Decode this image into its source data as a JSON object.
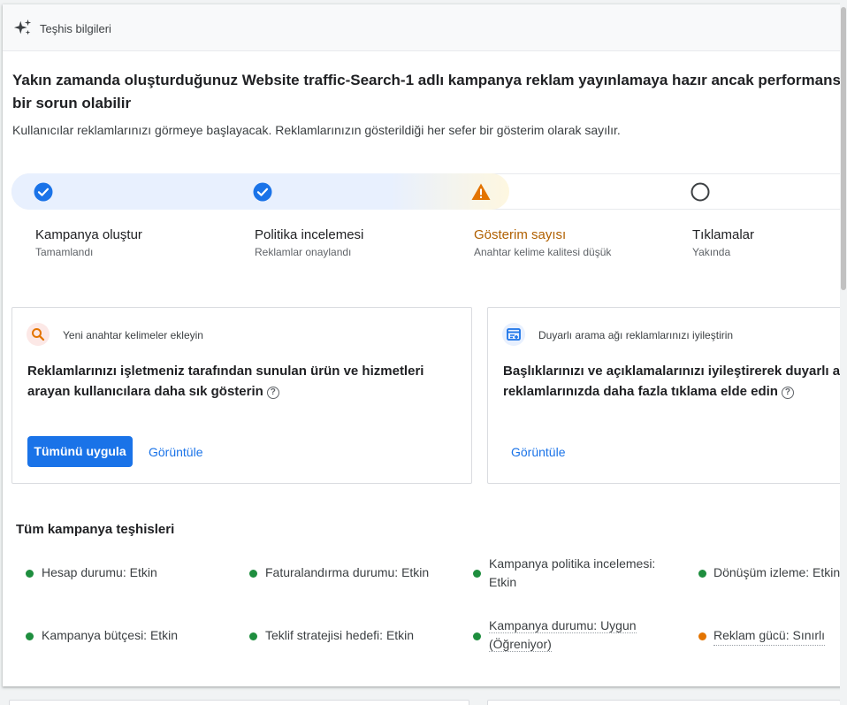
{
  "header": {
    "title": "Teşhis bilgileri",
    "icon": "sparkle-icon"
  },
  "headline": "Yakın zamanda oluşturduğunuz Website traffic-Search-1 adlı kampanya reklam yayınlamaya hazır ancak performansta bir sorun olabilir",
  "subtext": "Kullanıcılar reklamlarınızı görmeye başlayacak. Reklamlarınızın gösterildiği her sefer bir gösterim olarak sayılır.",
  "progress": {
    "steps": [
      {
        "title": "Kampanya oluştur",
        "subtitle": "Tamamlandı",
        "status": "done",
        "icon": "check-circle-icon"
      },
      {
        "title": "Politika incelemesi",
        "subtitle": "Reklamlar onaylandı",
        "status": "done",
        "icon": "check-circle-icon"
      },
      {
        "title": "Gösterim sayısı",
        "subtitle": "Anahtar kelime kalitesi düşük",
        "status": "warning",
        "icon": "warning-icon"
      },
      {
        "title": "Tıklamalar",
        "subtitle": "Yakında",
        "status": "pending",
        "icon": "empty-circle-icon"
      }
    ]
  },
  "recommendations": [
    {
      "label": "Yeni anahtar kelimeler ekleyin",
      "icon": "search-icon",
      "line1": "Reklamlarınızı işletmeniz tarafından sunulan ürün ve hizmetleri",
      "line2": "arayan kullanıcılara daha sık gösterin",
      "primary_button": "Tümünü uygula",
      "link": "Görüntüle"
    },
    {
      "label": "Duyarlı arama ağı reklamlarınızı iyileştirin",
      "icon": "ad-edit-icon",
      "line1": "Başlıklarınızı ve açıklamalarınızı iyileştirerek duyarlı arama ağı",
      "line2": "reklamlarınızda daha fazla tıklama elde edin",
      "link": "Görüntüle"
    }
  ],
  "diagnostics": {
    "title": "Tüm kampanya teşhisleri",
    "items": [
      {
        "text": "Hesap durumu: Etkin",
        "status": "ok"
      },
      {
        "text": "Faturalandırma durumu: Etkin",
        "status": "ok"
      },
      {
        "line1": "Kampanya politika incelemesi:",
        "line2": "Etkin",
        "status": "ok"
      },
      {
        "text": "Dönüşüm izleme: Etkin",
        "status": "ok"
      },
      {
        "text": "Kampanya bütçesi: Etkin",
        "status": "ok"
      },
      {
        "text": "Teklif stratejisi hedefi: Etkin",
        "status": "ok"
      },
      {
        "line1": "Kampanya durumu: Uygun",
        "line2": "(Öğreniyor)",
        "status": "ok"
      },
      {
        "text": "Reklam gücü: Sınırlı",
        "status": "warning"
      }
    ]
  },
  "colors": {
    "accent": "#1a73e8",
    "success": "#1e8e3e",
    "warning": "#e37400",
    "warning_text": "#b06000"
  }
}
